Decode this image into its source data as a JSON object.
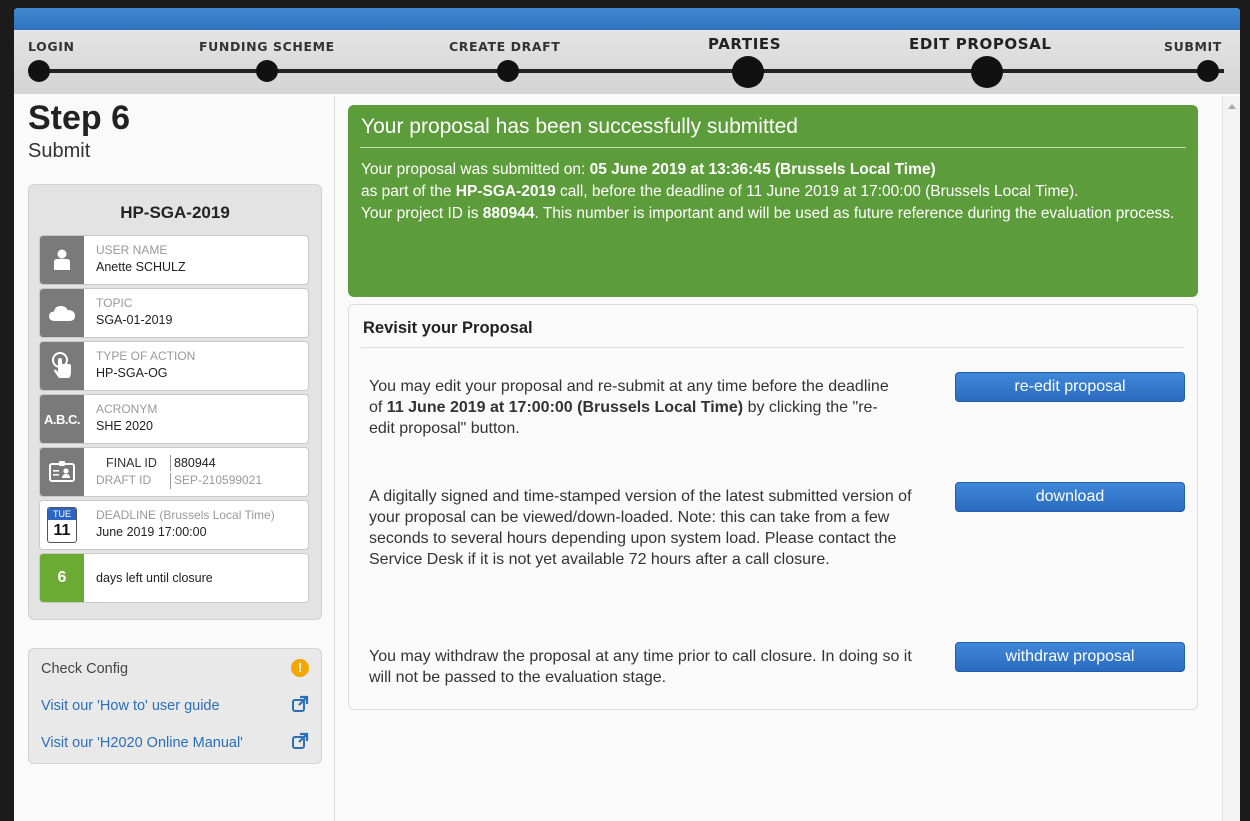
{
  "progress": {
    "steps": [
      {
        "label": "LOGIN"
      },
      {
        "label": "FUNDING SCHEME"
      },
      {
        "label": "CREATE DRAFT"
      },
      {
        "label": "PARTIES"
      },
      {
        "label": "EDIT PROPOSAL"
      },
      {
        "label": "SUBMIT"
      }
    ]
  },
  "step": {
    "title": "Step 6",
    "subtitle": "Submit"
  },
  "info": {
    "call": "HP-SGA-2019",
    "user_name_label": "USER NAME",
    "user_name": "Anette SCHULZ",
    "topic_label": "TOPIC",
    "topic": "SGA-01-2019",
    "action_label": "TYPE OF ACTION",
    "action": "HP-SGA-OG",
    "acronym_icon": "A.B.C.",
    "acronym_label": "ACRONYM",
    "acronym": "SHE 2020",
    "final_id_label": "FINAL ID",
    "final_id": "880944",
    "draft_id_label": "DRAFT ID",
    "draft_id": "SEP-210599021",
    "cal_month": "TUE",
    "cal_day": "11",
    "deadline_label": "DEADLINE (Brussels Local Time)",
    "deadline": "June 2019 17:00:00",
    "days_left": "6",
    "days_left_text": "days left until closure"
  },
  "check": {
    "config": "Check Config",
    "guide": "Visit our 'How to' user guide",
    "manual": "Visit our 'H2020 Online Manual'"
  },
  "success": {
    "title": "Your proposal has been successfully submitted",
    "l1a": "Your proposal was submitted on: ",
    "l1b": "05 June 2019 at 13:36:45 (Brussels Local Time)",
    "l2a": "as part of the ",
    "l2b": "HP-SGA-2019",
    "l2c": " call, before the deadline of 11 June 2019 at 17:00:00 (Brussels Local Time).",
    "l3a": "Your project ID is ",
    "l3b": "880944",
    "l3c": ". This number is important and will be used as future reference during the evaluation process."
  },
  "revisit": {
    "title": "Revisit your Proposal",
    "edit_a": "You may edit your proposal and re-submit at any time before the deadline of ",
    "edit_b": "11 June 2019 at 17:00:00 (Brussels Local Time)",
    "edit_c": " by clicking the \"re-edit proposal\" button.",
    "edit_btn": "re-edit proposal",
    "download_text": "A digitally signed and time-stamped version of the latest submitted version of your proposal can be viewed/down-loaded. Note: this can take from a few seconds to several hours depending upon system load. Please contact the Service Desk if it is not yet available 72 hours after a call closure.",
    "download_btn": "download",
    "withdraw_text": "You may withdraw the proposal at any time prior to call closure. In doing so it will not be passed to the evaluation stage.",
    "withdraw_btn": "withdraw proposal"
  }
}
